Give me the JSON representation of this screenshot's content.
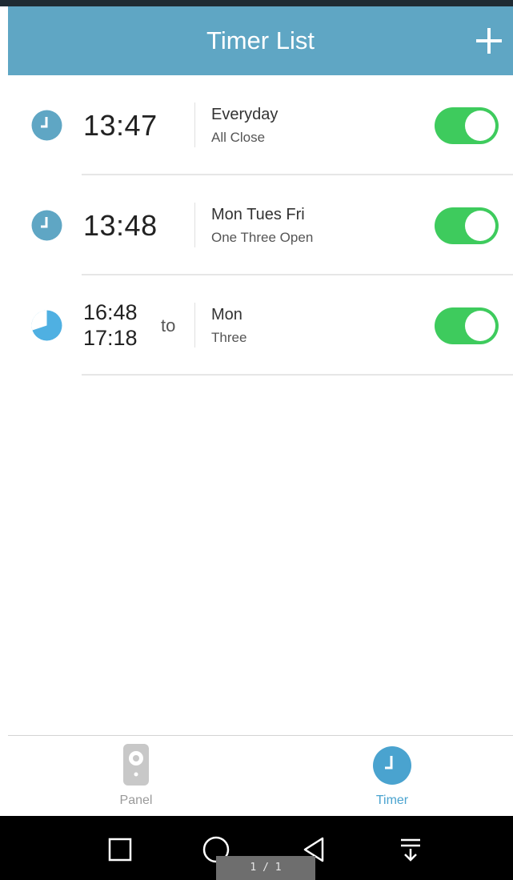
{
  "header": {
    "title": "Timer List",
    "add_icon": "plus-icon"
  },
  "timers": [
    {
      "icon": "clock-icon",
      "time": "13:47",
      "days": "Everyday",
      "action": "All Close",
      "enabled": true
    },
    {
      "icon": "clock-icon",
      "time": "13:48",
      "days": "Mon Tues Fri",
      "action": "One Three Open",
      "enabled": true
    },
    {
      "icon": "clock-range-icon",
      "start": "16:48",
      "end": "17:18",
      "to": "to",
      "days": "Mon",
      "action": "Three",
      "enabled": true
    }
  ],
  "tabs": [
    {
      "label": "Panel",
      "icon": "remote-panel-icon",
      "active": false
    },
    {
      "label": "Timer",
      "icon": "clock-icon",
      "active": true
    }
  ],
  "system_nav": {
    "buttons": [
      "recent-apps-icon",
      "home-icon",
      "back-icon",
      "notification-icon"
    ],
    "page_indicator": "1 / 1"
  },
  "colors": {
    "header": "#5fa6c4",
    "clock_icon": "#5fa6c4",
    "toggle_on": "#3ecb5d",
    "active_tab": "#4aa3cf"
  }
}
